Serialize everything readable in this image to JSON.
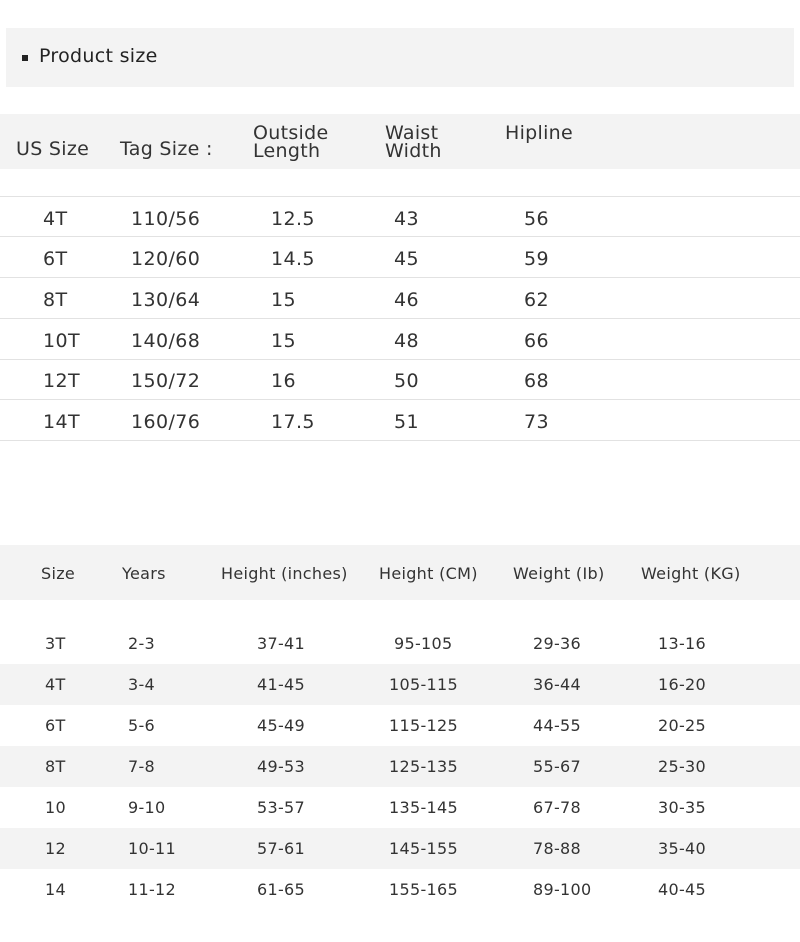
{
  "section": {
    "title": "Product size"
  },
  "table1": {
    "headers": [
      {
        "line1": "US Size",
        "line2": ""
      },
      {
        "line1": "Tag Size :",
        "line2": ""
      },
      {
        "line1": "Outside",
        "line2": "Length"
      },
      {
        "line1": "Waist",
        "line2": "Width"
      },
      {
        "line1": "Hipline",
        "line2": ""
      }
    ],
    "rows": [
      [
        "4T",
        "110/56",
        "12.5",
        "43",
        "56"
      ],
      [
        "6T",
        "120/60",
        "14.5",
        "45",
        "59"
      ],
      [
        "8T",
        "130/64",
        "15",
        "46",
        "62"
      ],
      [
        "10T",
        "140/68",
        "15",
        "48",
        "66"
      ],
      [
        "12T",
        "150/72",
        "16",
        "50",
        "68"
      ],
      [
        "14T",
        "160/76",
        "17.5",
        "51",
        "73"
      ]
    ]
  },
  "table2": {
    "headers": [
      "Size",
      "Years",
      "Height (inches)",
      "Height (CM)",
      "Weight (Ib)",
      "Weight (KG)"
    ],
    "rows": [
      [
        "3T",
        "2-3",
        "37-41",
        "95-105",
        "29-36",
        "13-16"
      ],
      [
        "4T",
        "3-4",
        "41-45",
        "105-115",
        "36-44",
        "16-20"
      ],
      [
        "6T",
        "5-6",
        "45-49",
        "115-125",
        "44-55",
        "20-25"
      ],
      [
        "8T",
        "7-8",
        "49-53",
        "125-135",
        "55-67",
        "25-30"
      ],
      [
        "10",
        "9-10",
        "53-57",
        "135-145",
        "67-78",
        "30-35"
      ],
      [
        "12",
        "10-11",
        "57-61",
        "145-155",
        "78-88",
        "35-40"
      ],
      [
        "14",
        "11-12",
        "61-65",
        "155-165",
        "89-100",
        "40-45"
      ]
    ]
  }
}
